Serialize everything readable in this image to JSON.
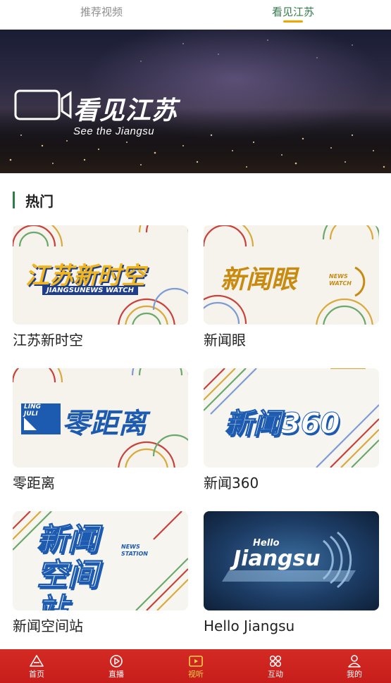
{
  "tabs": [
    {
      "label": "推荐视频",
      "active": false
    },
    {
      "label": "看见江苏",
      "active": true
    }
  ],
  "banner": {
    "title": "看见江苏",
    "subtitle": "See the Jiangsu"
  },
  "section": {
    "title": "热门"
  },
  "programs": [
    {
      "label": "江苏新时空",
      "logo_main": "江苏新时空",
      "logo_sub": "JIANGSUNEWS WATCH"
    },
    {
      "label": "新闻眼",
      "logo_main": "新闻眼",
      "logo_sub": "NEWS WATCH"
    },
    {
      "label": "零距离",
      "logo_main": "零距离",
      "logo_sub": "LING JULI"
    },
    {
      "label": "新闻360",
      "logo_main": "新闻360",
      "logo_sub": ""
    },
    {
      "label": "新闻空间站",
      "logo_main": "新闻空间站",
      "logo_sub": "NEWS STATION"
    },
    {
      "label": "Hello Jiangsu",
      "logo_main": "Jiangsu",
      "logo_sub": "Hello"
    }
  ],
  "bottom_nav": [
    {
      "label": "首页",
      "icon": "home-icon",
      "active": false
    },
    {
      "label": "直播",
      "icon": "play-circle-icon",
      "active": false
    },
    {
      "label": "视听",
      "icon": "tv-icon",
      "active": true
    },
    {
      "label": "互动",
      "icon": "grid-icon",
      "active": false
    },
    {
      "label": "我的",
      "icon": "user-icon",
      "active": false
    }
  ],
  "colors": {
    "accent_green": "#2f7d4a",
    "tab_underline": "#f0a500",
    "nav_red": "#c81e1b",
    "nav_active": "#ffd24a"
  }
}
